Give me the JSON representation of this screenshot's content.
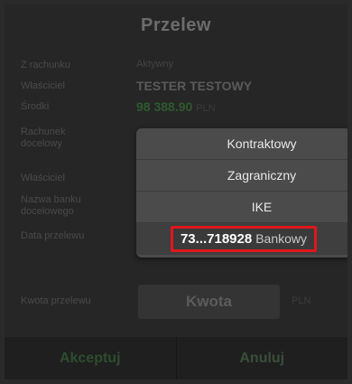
{
  "title": "Przelew",
  "form": {
    "from_label": "Z rachunku",
    "from_value": "Aktywny",
    "owner_label": "Właściciel",
    "owner_value": "TESTER TESTOWY",
    "funds_label": "Środki",
    "funds_value": "98 388.90",
    "funds_currency": "PLN",
    "target_label": "Rachunek docelowy",
    "recipient_label": "Właściciel",
    "bank_label": "Nazwa banku docelowego",
    "date_label": "Data przelewu",
    "amount_label": "Kwota przelewu",
    "amount_placeholder": "Kwota",
    "amount_currency": "PLN"
  },
  "account_menu": {
    "options": [
      "Kontraktowy",
      "Zagraniczny",
      "IKE"
    ],
    "selected_account": "73...718928",
    "selected_type": "Bankowy",
    "highlight_color": "#e0161e"
  },
  "buttons": {
    "accept": "Akceptuj",
    "cancel": "Anuluj"
  }
}
